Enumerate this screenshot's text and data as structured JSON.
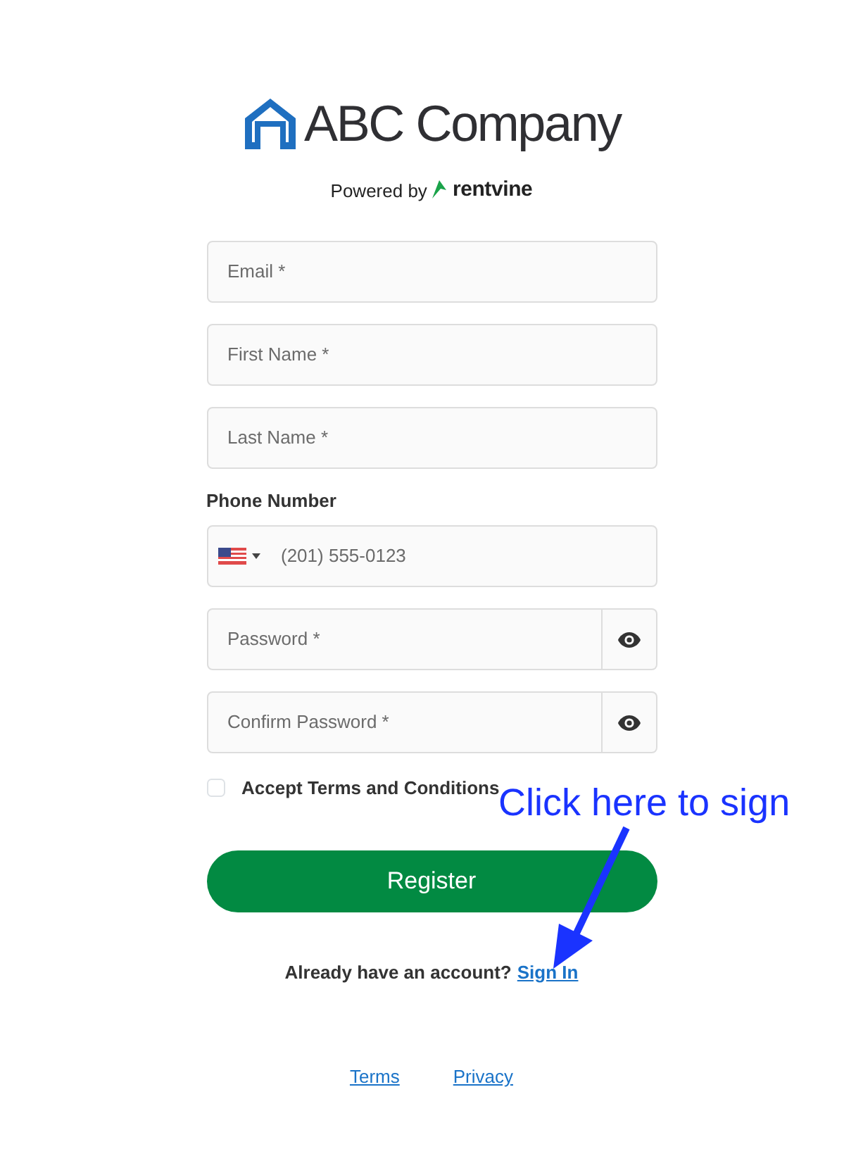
{
  "brand": {
    "name": "ABC Company",
    "powered_by": "Powered by",
    "platform": "rentvine"
  },
  "fields": [
    {
      "kind": "text",
      "placeholder": "Email *"
    },
    {
      "kind": "text",
      "placeholder": "First Name *"
    },
    {
      "kind": "text",
      "placeholder": "Last Name *"
    },
    {
      "kind": "phone",
      "label": "Phone Number",
      "placeholder": "(201) 555-0123"
    },
    {
      "kind": "password",
      "placeholder": "Password *"
    },
    {
      "kind": "password",
      "placeholder": "Confirm Password *"
    }
  ],
  "terms": {
    "label": "Accept Terms and Conditions",
    "checked": false
  },
  "register_button": "Register",
  "sign_in": {
    "text": "Already have an account?",
    "link": "Sign In"
  },
  "footer_links": [
    "Terms",
    "Privacy"
  ],
  "annotation": {
    "text": "Click here to sign"
  }
}
